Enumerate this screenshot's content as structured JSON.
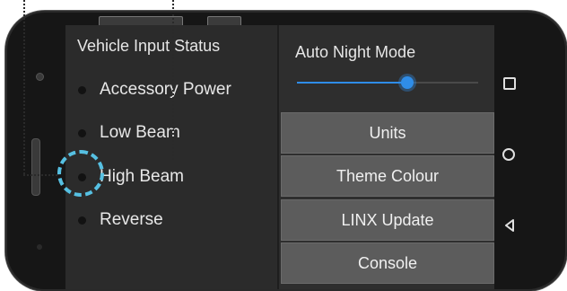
{
  "vehicle_input": {
    "title": "Vehicle Input Status",
    "items": [
      {
        "label": "Accessory Power",
        "active": false
      },
      {
        "label": "Low Beam",
        "active": false
      },
      {
        "label": "High Beam",
        "active": false
      },
      {
        "label": "Reverse",
        "active": false
      }
    ]
  },
  "settings": {
    "night_mode_label": "Auto Night Mode",
    "night_mode_level": 0.61,
    "buttons": [
      {
        "label": "Units"
      },
      {
        "label": "Theme Colour"
      },
      {
        "label": "LINX Update"
      },
      {
        "label": "Console"
      }
    ]
  },
  "navigation": {
    "icons": [
      "recent-apps-icon",
      "home-icon",
      "back-icon"
    ]
  },
  "colors": {
    "accent": "#2f8de8",
    "callout": "#56c0e2",
    "button_bg": "#5c5c5c",
    "panel_bg": "#2b2b2b"
  }
}
